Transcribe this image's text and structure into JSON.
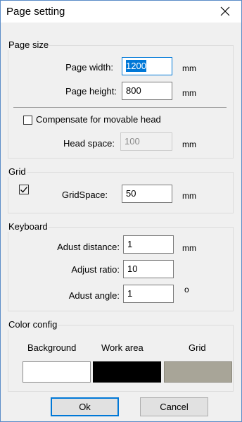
{
  "window": {
    "title": "Page setting",
    "close_glyph": "✕"
  },
  "page_size": {
    "group_label": "Page size",
    "width_label": "Page width:",
    "width_value": "1200",
    "width_unit": "mm",
    "height_label": "Page height:",
    "height_value": "800",
    "height_unit": "mm",
    "compensate_label": "Compensate for movable head",
    "compensate_checked": false,
    "head_space_label": "Head space:",
    "head_space_value": "100",
    "head_space_unit": "mm"
  },
  "grid": {
    "group_label": "Grid",
    "checked": true,
    "check_glyph": "✓",
    "space_label": "GridSpace:",
    "space_value": "50",
    "space_unit": "mm"
  },
  "keyboard": {
    "group_label": "Keyboard",
    "distance_label": "Adust distance:",
    "distance_value": "1",
    "distance_unit": "mm",
    "ratio_label": "Adjust ratio:",
    "ratio_value": "10",
    "angle_label": "Adust angle:",
    "angle_value": "1",
    "angle_unit": "o"
  },
  "color_config": {
    "group_label": "Color config",
    "background_label": "Background",
    "background_color": "#ffffff",
    "work_area_label": "Work area",
    "work_area_color": "#000000",
    "grid_label": "Grid",
    "grid_color": "#a8a598"
  },
  "buttons": {
    "ok_label": "Ok",
    "cancel_label": "Cancel"
  },
  "colors": {
    "accent": "#0078d7",
    "window_border": "#5b8cc7",
    "dialog_bg": "#f0f0f0"
  }
}
